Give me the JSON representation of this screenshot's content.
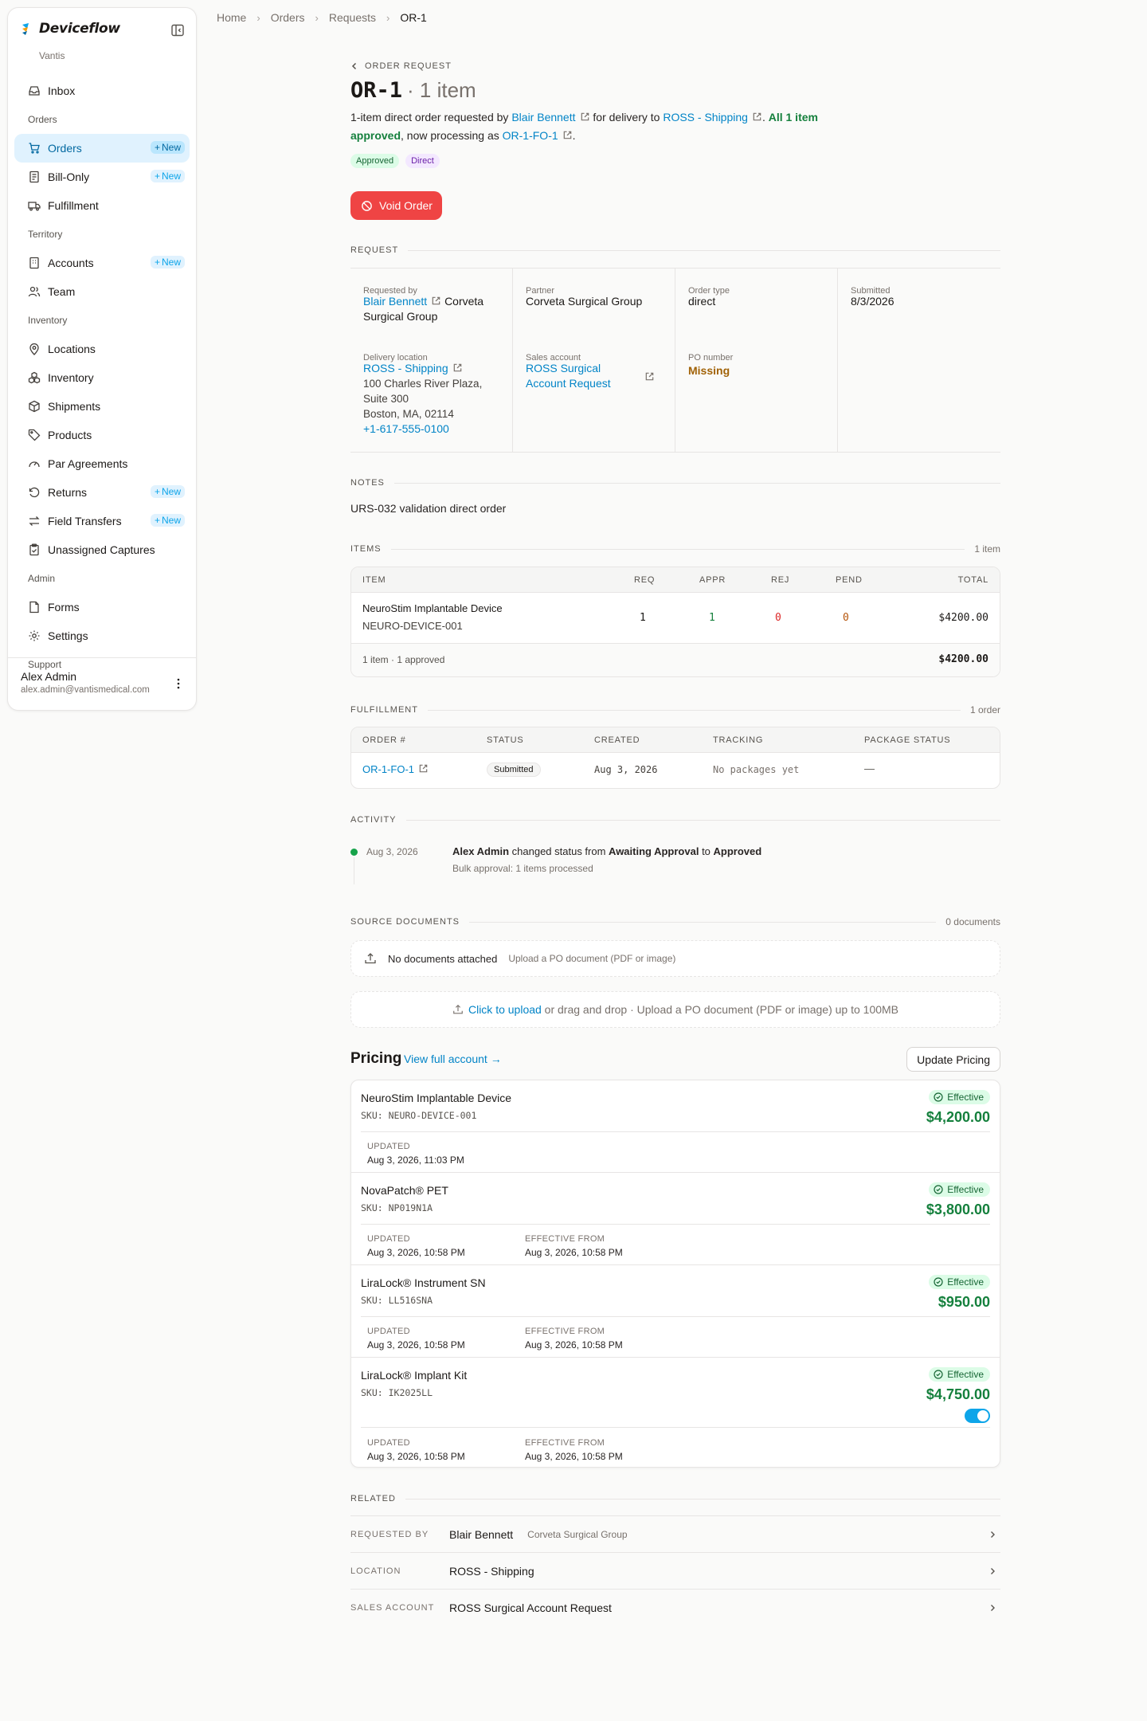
{
  "app": {
    "name": "Deviceflow",
    "org": "Vantis"
  },
  "colors": {
    "accent": "#0ea5e9",
    "danger": "#ef4444",
    "success": "#15803d"
  },
  "sidebar": {
    "inbox": "Inbox",
    "sections": {
      "orders": "Orders",
      "territory": "Territory",
      "inventory": "Inventory",
      "admin": "Admin",
      "support": "Support"
    },
    "items": {
      "orders": "Orders",
      "bill_only": "Bill-Only",
      "fulfillment": "Fulfillment",
      "accounts": "Accounts",
      "team": "Team",
      "locations": "Locations",
      "inventory": "Inventory",
      "shipments": "Shipments",
      "products": "Products",
      "par_agreements": "Par Agreements",
      "returns": "Returns",
      "field_transfers": "Field Transfers",
      "unassigned_captures": "Unassigned Captures",
      "forms": "Forms",
      "settings": "Settings"
    },
    "new_label": "New",
    "user": {
      "name": "Alex Admin",
      "email": "alex.admin@vantismedical.com"
    }
  },
  "breadcrumb": [
    "Home",
    "Orders",
    "Requests",
    "OR-1"
  ],
  "header": {
    "eyebrow": "Order Request",
    "id": "OR-1",
    "count": "· 1 item",
    "summary": {
      "p1": "1-item direct order requested by ",
      "requester": "Blair Bennett",
      "p2": " for delivery to ",
      "location": "ROSS - Shipping",
      "p3": ". ",
      "approved": "All 1 item approved",
      "p4": ", now processing as ",
      "fo": "OR-1-FO-1",
      "p5": "."
    },
    "badges": [
      "Approved",
      "Direct"
    ],
    "void_label": "Void Order"
  },
  "request": {
    "title": "Request",
    "requested_by_label": "Requested by",
    "requested_by_name": "Blair Bennett",
    "requested_by_org": "Corveta Surgical Group",
    "partner_label": "Partner",
    "partner": "Corveta Surgical Group",
    "order_type_label": "Order type",
    "order_type": "direct",
    "submitted_label": "Submitted",
    "submitted": "8/3/2026",
    "delivery_label": "Delivery location",
    "delivery_name": "ROSS - Shipping",
    "delivery_address": [
      "100 Charles River Plaza,",
      "Suite 300",
      "Boston, MA, 02114"
    ],
    "delivery_phone": "+1-617-555-0100",
    "sales_label": "Sales account",
    "sales_account": "ROSS Surgical Account Request",
    "po_label": "PO number",
    "po_value": "Missing"
  },
  "notes": {
    "title": "Notes",
    "text": "URS-032 validation direct order"
  },
  "items": {
    "title": "Items",
    "count": "1 item",
    "headers": [
      "Item",
      "Req",
      "Appr",
      "Rej",
      "Pend",
      "Total"
    ],
    "rows": [
      {
        "name": "NeuroStim Implantable Device",
        "sku": "NEURO-DEVICE-001",
        "req": "1",
        "appr": "1",
        "rej": "0",
        "pend": "0",
        "total": "$4200.00"
      }
    ],
    "footer_summary": "1 item · 1 approved",
    "footer_total": "$4200.00"
  },
  "fulfillment": {
    "title": "Fulfillment",
    "count": "1 order",
    "headers": [
      "Order #",
      "Status",
      "Created",
      "Tracking",
      "Package Status"
    ],
    "rows": [
      {
        "order": "OR-1-FO-1",
        "status": "Submitted",
        "created": "Aug 3, 2026",
        "tracking": "No packages yet",
        "package_status": "—"
      }
    ]
  },
  "activity": {
    "title": "Activity",
    "entries": [
      {
        "date": "Aug 3, 2026",
        "actor": "Alex Admin",
        "t1": " changed status from ",
        "from": "Awaiting Approval",
        "t2": " to ",
        "to": "Approved",
        "sub": "Bulk approval: 1 items processed"
      }
    ]
  },
  "documents": {
    "title": "Source Documents",
    "count": "0 documents",
    "empty_title": "No documents attached",
    "empty_sub": "Upload a PO document (PDF or image)",
    "upload_link": "Click to upload",
    "upload_text": " or drag and drop · Upload a PO document (PDF or image) up to 100MB"
  },
  "pricing": {
    "title": "Pricing",
    "link": "View full account →",
    "update_label": "Update Pricing",
    "updated_label": "Updated",
    "effective_from_label": "Effective From",
    "items": [
      {
        "name": "NeuroStim Implantable Device",
        "sku": "SKU: NEURO-DEVICE-001",
        "status": "Effective",
        "price": "$4,200.00",
        "updated": "Aug 3, 2026, 11:03 PM",
        "effective_from": ""
      },
      {
        "name": "NovaPatch® PET",
        "sku": "SKU: NP019N1A",
        "status": "Effective",
        "price": "$3,800.00",
        "updated": "Aug 3, 2026, 10:58 PM",
        "effective_from": "Aug 3, 2026, 10:58 PM"
      },
      {
        "name": "LiraLock® Instrument SN",
        "sku": "SKU: LL516SNA",
        "status": "Effective",
        "price": "$950.00",
        "updated": "Aug 3, 2026, 10:58 PM",
        "effective_from": "Aug 3, 2026, 10:58 PM"
      },
      {
        "name": "LiraLock® Implant Kit",
        "sku": "SKU: IK2025LL",
        "status": "Effective",
        "price": "$4,750.00",
        "updated": "Aug 3, 2026, 10:58 PM",
        "effective_from": "Aug 3, 2026, 10:58 PM",
        "toggle_on": true
      }
    ]
  },
  "related": {
    "title": "Related",
    "rows": [
      {
        "label": "Requested By",
        "value": "Blair Bennett",
        "sub": "Corveta Surgical Group"
      },
      {
        "label": "Location",
        "value": "ROSS - Shipping",
        "sub": ""
      },
      {
        "label": "Sales Account",
        "value": "ROSS Surgical Account Request",
        "sub": ""
      }
    ]
  }
}
